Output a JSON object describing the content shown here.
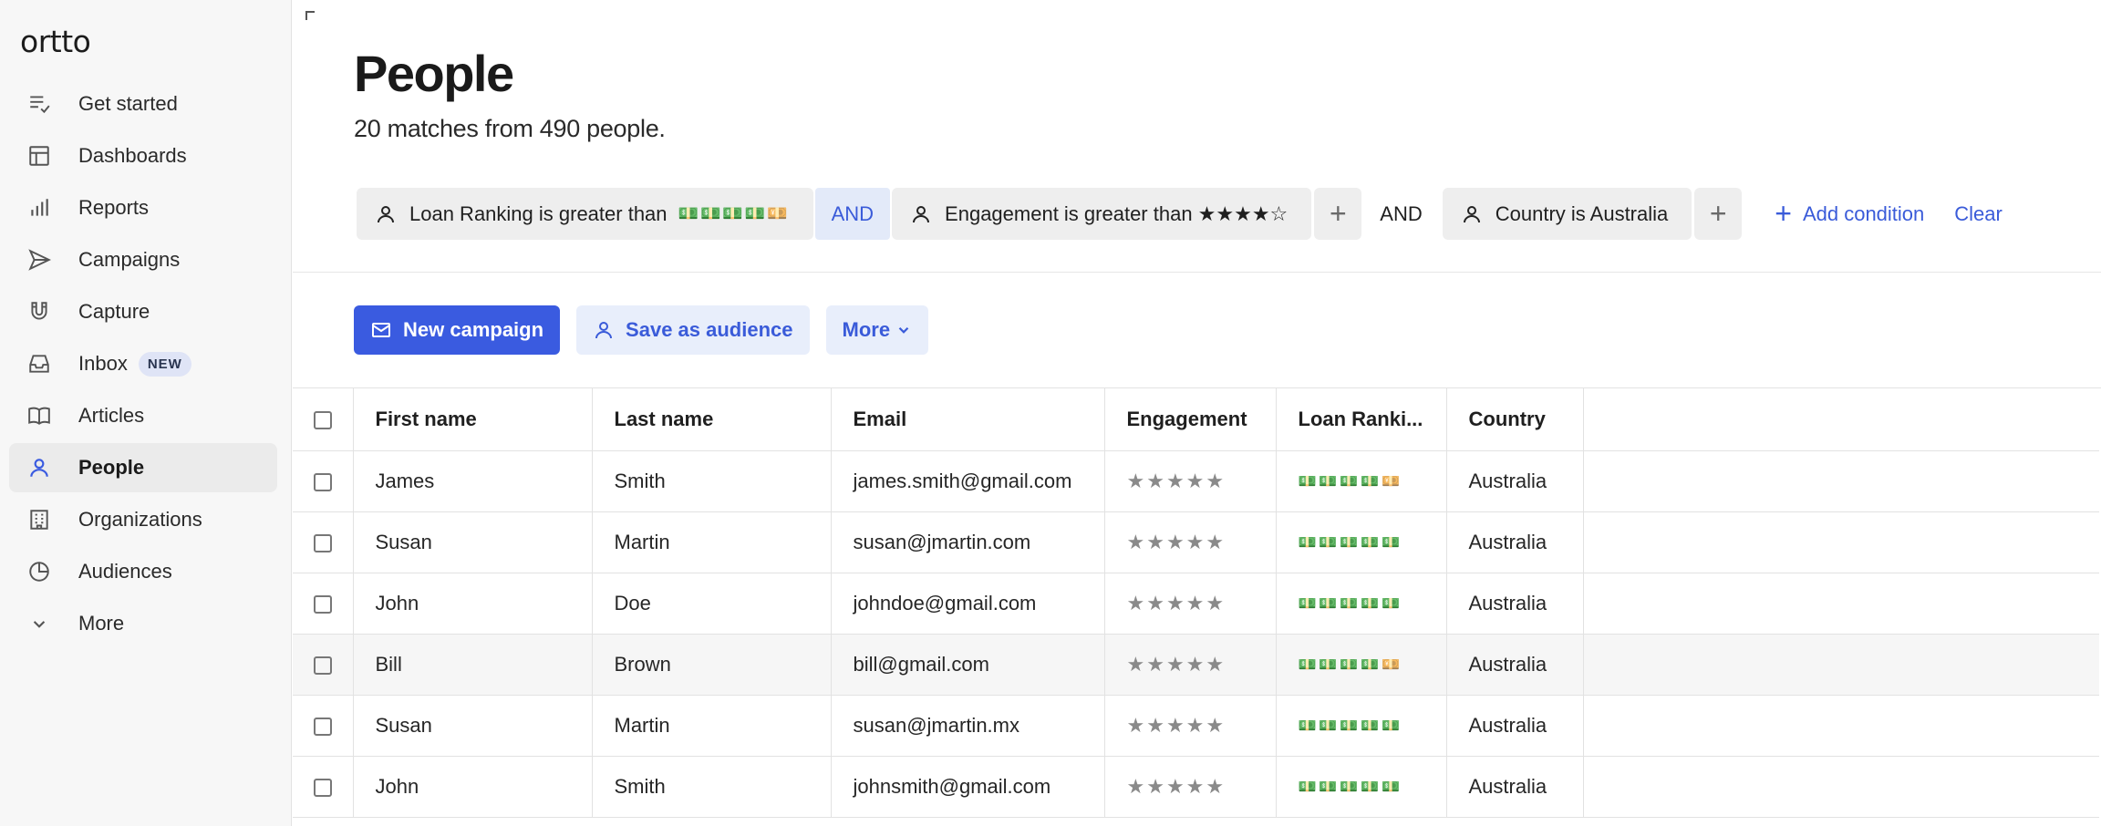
{
  "app": {
    "logo": "ortto"
  },
  "sidebar": {
    "items": [
      {
        "label": "Get started",
        "icon": "checklist-icon"
      },
      {
        "label": "Dashboards",
        "icon": "dashboard-icon"
      },
      {
        "label": "Reports",
        "icon": "bar-chart-icon"
      },
      {
        "label": "Campaigns",
        "icon": "send-icon"
      },
      {
        "label": "Capture",
        "icon": "magnet-icon"
      },
      {
        "label": "Inbox",
        "icon": "inbox-icon",
        "badge": "NEW"
      },
      {
        "label": "Articles",
        "icon": "book-icon"
      },
      {
        "label": "People",
        "icon": "person-icon",
        "active": true
      },
      {
        "label": "Organizations",
        "icon": "building-icon"
      },
      {
        "label": "Audiences",
        "icon": "pie-icon"
      },
      {
        "label": "More",
        "icon": "chevron-down-icon"
      }
    ]
  },
  "main": {
    "title": "People",
    "subtitle": "20 matches from 490 people."
  },
  "filters": {
    "condition1": "Loan Ranking is greater than",
    "condition1_value": "💵💵💵💵💴",
    "and1": "AND",
    "condition2": "Engagement is greater than ★★★★☆",
    "and2": "AND",
    "condition3": "Country is Australia",
    "plus": "+",
    "add_condition": "Add condition",
    "clear": "Clear"
  },
  "actions": {
    "new_campaign": "New campaign",
    "save_audience": "Save as audience",
    "more": "More"
  },
  "table": {
    "columns": [
      "First name",
      "Last name",
      "Email",
      "Engagement",
      "Loan Ranki...",
      "Country"
    ],
    "rows": [
      {
        "first": "James",
        "last": "Smith",
        "email": "james.smith@gmail.com",
        "engagement": "★★★★★",
        "loan": "💵💵💵💵💴",
        "country": "Australia"
      },
      {
        "first": "Susan",
        "last": "Martin",
        "email": "susan@jmartin.com",
        "engagement": "★★★★★",
        "loan": "💵💵💵💵💵",
        "country": "Australia"
      },
      {
        "first": "John",
        "last": "Doe",
        "email": "johndoe@gmail.com",
        "engagement": "★★★★★",
        "loan": "💵💵💵💵💵",
        "country": "Australia"
      },
      {
        "first": "Bill",
        "last": "Brown",
        "email": "bill@gmail.com",
        "engagement": "★★★★★",
        "loan": "💵💵💵💵💴",
        "country": "Australia"
      },
      {
        "first": "Susan",
        "last": "Martin",
        "email": "susan@jmartin.mx",
        "engagement": "★★★★★",
        "loan": "💵💵💵💵💵",
        "country": "Australia"
      },
      {
        "first": "John",
        "last": "Smith",
        "email": "johnsmith@gmail.com",
        "engagement": "★★★★★",
        "loan": "💵💵💵💵💵",
        "country": "Australia"
      }
    ]
  },
  "colors": {
    "accent": "#3a5be0",
    "link": "#3a5bd9",
    "sidebar_bg": "#f7f7f7",
    "active_bg": "#ebebeb"
  }
}
